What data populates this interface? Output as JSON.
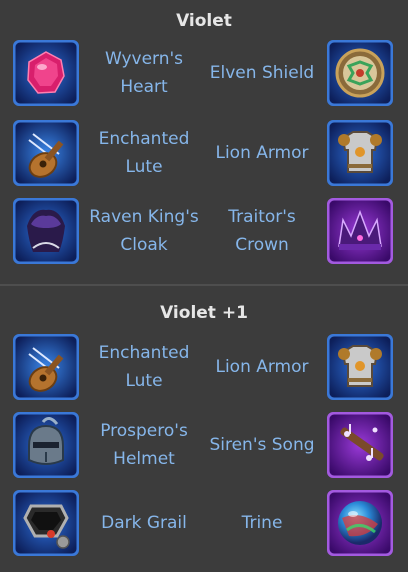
{
  "sections": [
    {
      "title": "Violet",
      "rows": [
        {
          "left": {
            "name": "Wyvern's Heart",
            "icon": "wyverns-heart-icon"
          },
          "right": {
            "name": "Elven Shield",
            "icon": "elven-shield-icon"
          }
        },
        {
          "left": {
            "name": "Enchanted Lute",
            "icon": "enchanted-lute-icon"
          },
          "right": {
            "name": "Lion Armor",
            "icon": "lion-armor-icon"
          }
        },
        {
          "left": {
            "name": "Raven King's Cloak",
            "icon": "raven-kings-cloak-icon"
          },
          "right": {
            "name": "Traitor's Crown",
            "icon": "traitors-crown-icon"
          }
        }
      ]
    },
    {
      "title": "Violet +1",
      "rows": [
        {
          "left": {
            "name": "Enchanted Lute",
            "icon": "enchanted-lute-icon"
          },
          "right": {
            "name": "Lion Armor",
            "icon": "lion-armor-icon"
          }
        },
        {
          "left": {
            "name": "Prospero's Helmet",
            "icon": "prosperos-helmet-icon"
          },
          "right": {
            "name": "Siren's Song",
            "icon": "sirens-song-icon"
          }
        },
        {
          "left": {
            "name": "Dark Grail",
            "icon": "dark-grail-icon"
          },
          "right": {
            "name": "Trine",
            "icon": "trine-icon"
          }
        }
      ]
    }
  ],
  "colors": {
    "background": "#3c3c3c",
    "title_text": "#e6e6e6",
    "item_text": "#86b6ea",
    "frame_blue": "#3a78d8",
    "frame_purple": "#a35ae0"
  }
}
